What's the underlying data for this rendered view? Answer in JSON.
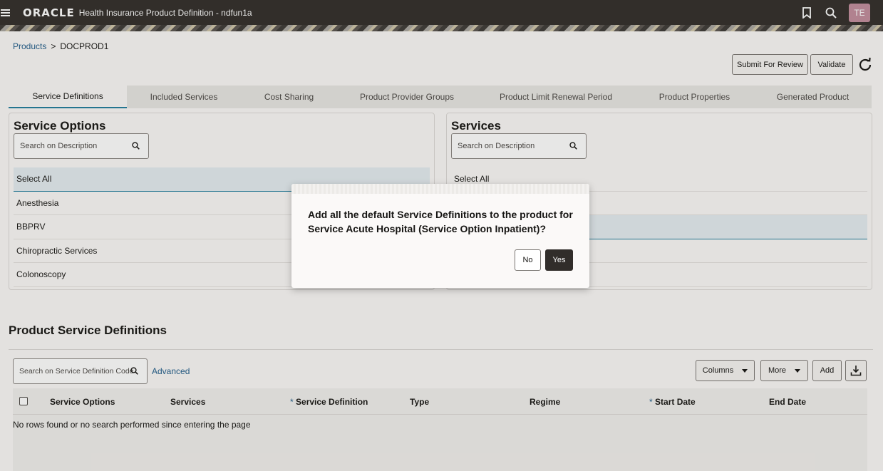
{
  "header": {
    "brand": "ORACLE",
    "app_title": "Health Insurance Product Definition - ndfun1a",
    "avatar_initials": "TE"
  },
  "breadcrumb": {
    "parent": "Products",
    "separator": ">",
    "current": "DOCPROD1"
  },
  "actions": {
    "submit_label": "Submit For Review",
    "validate_label": "Validate"
  },
  "tabs": [
    {
      "label": "Service Definitions",
      "active": true
    },
    {
      "label": "Included Services"
    },
    {
      "label": "Cost Sharing"
    },
    {
      "label": "Product Provider Groups"
    },
    {
      "label": "Product Limit Renewal Period"
    },
    {
      "label": "Product Properties"
    },
    {
      "label": "Generated Product"
    }
  ],
  "service_options": {
    "title": "Service Options",
    "search_placeholder": "Search on Description",
    "items": [
      "Select All",
      "Anesthesia",
      "BBPRV",
      "Chiropractic Services",
      "Colonoscopy"
    ]
  },
  "services": {
    "title": "Services",
    "search_placeholder": "Search on Description",
    "items": [
      "Select All",
      "",
      "",
      "",
      ""
    ]
  },
  "psd": {
    "title": "Product Service Definitions",
    "search_placeholder": "Search on Service Definition Code",
    "advanced_label": "Advanced",
    "columns_label": "Columns",
    "more_label": "More",
    "add_label": "Add",
    "columns": [
      "Service Options",
      "Services",
      "Service Definition",
      "Type",
      "Regime",
      "Start Date",
      "End Date"
    ],
    "required_marker": "*",
    "empty_message": "No rows found or no search performed since entering the page"
  },
  "dialog": {
    "message": "Add all the default Service Definitions to the product for Service Acute Hospital (Service Option Inpatient)?",
    "no_label": "No",
    "yes_label": "Yes"
  }
}
